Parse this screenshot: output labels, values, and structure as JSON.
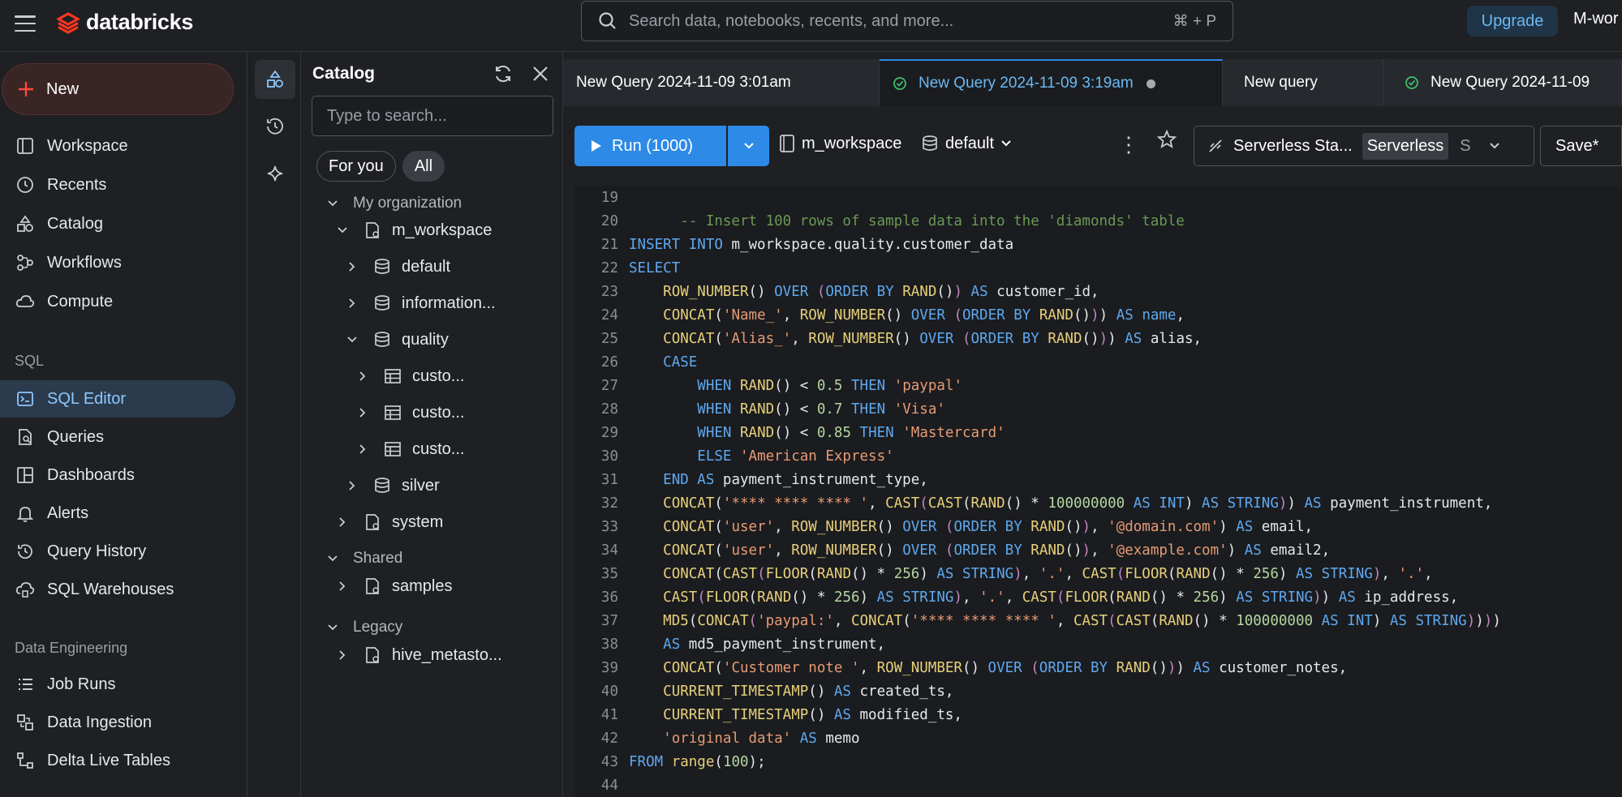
{
  "app": {
    "name": "databricks"
  },
  "search": {
    "placeholder": "Search data, notebooks, recents, and more...",
    "shortcut": "⌘ + P"
  },
  "header": {
    "upgrade_label": "Upgrade",
    "workspace_label": "M-wor"
  },
  "nav": {
    "new_label": "New",
    "items": [
      {
        "label": "Workspace",
        "icon": "workspace-icon"
      },
      {
        "label": "Recents",
        "icon": "clock-icon"
      },
      {
        "label": "Catalog",
        "icon": "catalog-icon"
      },
      {
        "label": "Workflows",
        "icon": "workflows-icon"
      },
      {
        "label": "Compute",
        "icon": "cloud-icon"
      }
    ],
    "sql_section": "SQL",
    "sql_items": [
      {
        "label": "SQL Editor",
        "icon": "sql-editor-icon",
        "active": true
      },
      {
        "label": "Queries",
        "icon": "queries-icon"
      },
      {
        "label": "Dashboards",
        "icon": "dashboards-icon"
      },
      {
        "label": "Alerts",
        "icon": "bell-icon"
      },
      {
        "label": "Query History",
        "icon": "history-icon"
      },
      {
        "label": "SQL Warehouses",
        "icon": "warehouse-icon"
      }
    ],
    "de_section": "Data Engineering",
    "de_items": [
      {
        "label": "Job Runs",
        "icon": "job-runs-icon"
      },
      {
        "label": "Data Ingestion",
        "icon": "ingestion-icon"
      },
      {
        "label": "Delta Live Tables",
        "icon": "pipeline-icon"
      }
    ]
  },
  "catalog": {
    "title": "Catalog",
    "search_placeholder": "Type to search...",
    "chips": [
      "For you",
      "All"
    ],
    "tree": {
      "my_org": "My organization",
      "workspace": "m_workspace",
      "default": "default",
      "information": "information...",
      "quality": "quality",
      "table1": "custo...",
      "table2": "custo...",
      "table3": "custo...",
      "silver": "silver",
      "system": "system",
      "shared": "Shared",
      "samples": "samples",
      "legacy": "Legacy",
      "hive": "hive_metasto..."
    }
  },
  "tabs": [
    {
      "label": "New Query 2024-11-09 3:01am"
    },
    {
      "label": "New Query 2024-11-09 3:19am",
      "active": true
    },
    {
      "label": "New query"
    },
    {
      "label": "New Query 2024-11-09"
    }
  ],
  "toolbar": {
    "run_label": "Run (1000)",
    "catalog_label": "m_workspace",
    "schema_label": "default",
    "warehouse_label": "Serverless Sta...",
    "warehouse_badge": "Serverless",
    "warehouse_size": "S",
    "save_label": "Save*"
  },
  "colors": {
    "accent": "#2d8ae6",
    "brand": "#ff3621",
    "active_nav": "#8cc8ff"
  }
}
